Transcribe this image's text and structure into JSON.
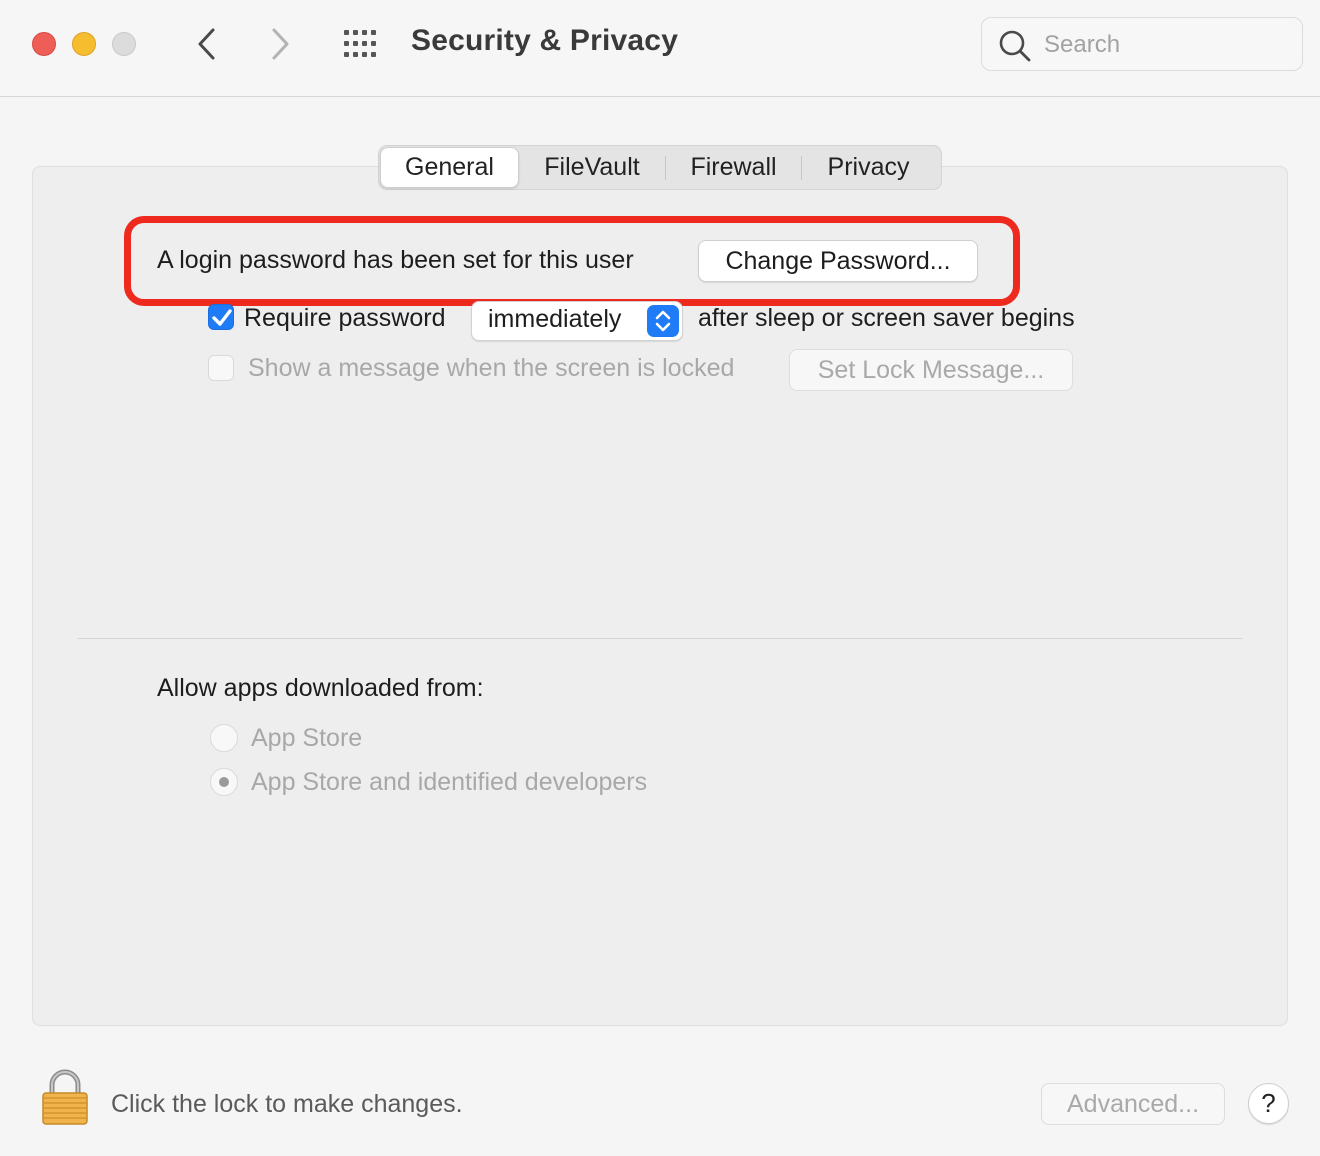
{
  "window": {
    "title": "Security & Privacy",
    "search": {
      "placeholder": "Search",
      "value": ""
    }
  },
  "tabs": [
    {
      "label": "General",
      "selected": true
    },
    {
      "label": "FileVault",
      "selected": false
    },
    {
      "label": "Firewall",
      "selected": false
    },
    {
      "label": "Privacy",
      "selected": false
    }
  ],
  "general": {
    "login_password_text": "A login password has been set for this user",
    "change_password_button": "Change Password...",
    "require_password": {
      "checked": true,
      "label": "Require password",
      "interval": "immediately",
      "suffix": "after sleep or screen saver begins"
    },
    "lock_message": {
      "checked": false,
      "enabled": false,
      "label": "Show a message when the screen is locked",
      "button": "Set Lock Message..."
    },
    "allow_apps": {
      "heading": "Allow apps downloaded from:",
      "options": [
        {
          "label": "App Store",
          "selected": false
        },
        {
          "label": "App Store and identified developers",
          "selected": true
        }
      ]
    }
  },
  "footer": {
    "lock_text": "Click the lock to make changes.",
    "advanced_button": "Advanced...",
    "help_label": "?"
  },
  "colors": {
    "accent": "#1f7bf6",
    "highlight": "#ee2a1f",
    "close": "#ee5e57",
    "minimize": "#f6bd2f",
    "zoom_disabled": "#dcdcdc"
  }
}
